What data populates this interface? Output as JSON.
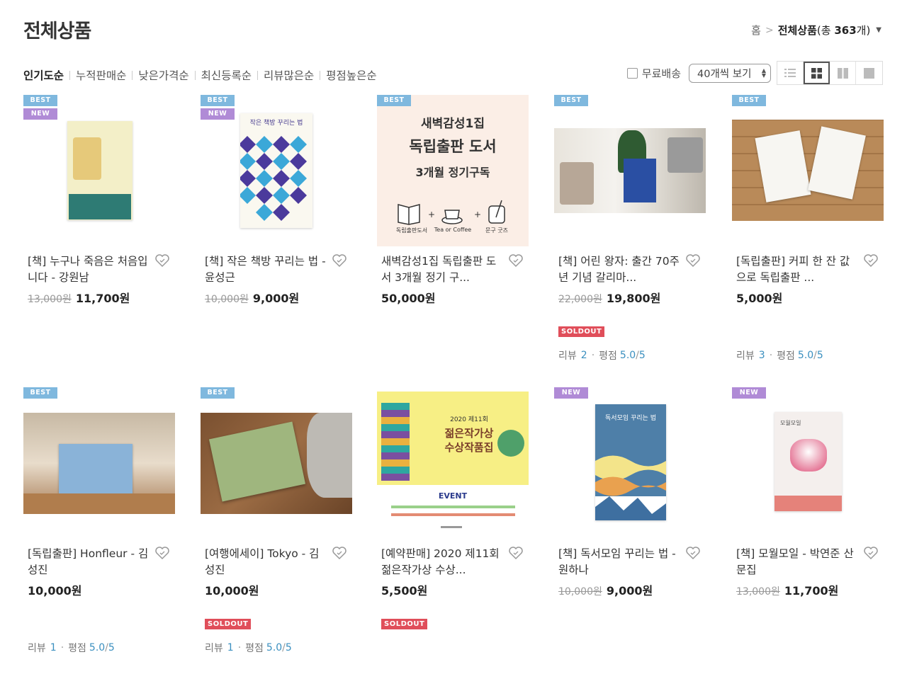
{
  "page": {
    "title": "전체상품"
  },
  "breadcrumb": {
    "home": "홈",
    "current": "전체상품",
    "count_prefix": "(총 ",
    "count_value": "363",
    "count_suffix": "개)"
  },
  "sort_tabs": [
    "인기도순",
    "누적판매순",
    "낮은가격순",
    "최신등록순",
    "리뷰많은순",
    "평점높은순"
  ],
  "toolbar": {
    "free_shipping_label": "무료배송",
    "view_count_value": "40개씩 보기"
  },
  "review_labels": {
    "review": "리뷰",
    "rating": "평점",
    "max": "5"
  },
  "soldout_label": "SOLDOUT",
  "badge_labels": {
    "best": "BEST",
    "new": "NEW"
  },
  "products": [
    {
      "title": "[책] 누구나 죽음은 처음입니다 - 강원남",
      "orig_price": "13,000원",
      "price": "11,700원",
      "badges": [
        "best",
        "new"
      ],
      "soldout": false,
      "review_count": "",
      "rating": "",
      "thumb_text": ""
    },
    {
      "title": "[책] 작은 책방 꾸리는 법 - 윤성근",
      "orig_price": "10,000원",
      "price": "9,000원",
      "badges": [
        "best",
        "new"
      ],
      "soldout": false,
      "review_count": "",
      "rating": "",
      "thumb_text": "작은 책방 꾸리는 법"
    },
    {
      "title": "새벽감성1집 독립출판 도서 3개월 정기 구...",
      "orig_price": "",
      "price": "50,000원",
      "badges": [
        "best"
      ],
      "soldout": false,
      "review_count": "",
      "rating": "",
      "thumb_text": "새벽감성1집",
      "thumb_text2": "독립출판 도서",
      "thumb_text3": "3개월 정기구독",
      "thumb_items": [
        "독립출판도서",
        "Tea or Coffee",
        "문구 굿즈"
      ]
    },
    {
      "title": "[책] 어린 왕자: 출간 70주년 기념 갈리마...",
      "orig_price": "22,000원",
      "price": "19,800원",
      "badges": [
        "best"
      ],
      "soldout": true,
      "review_count": "2",
      "rating": "5.0",
      "thumb_text": ""
    },
    {
      "title": "[독립출판] 커피 한 잔 값으로 독립출판 ...",
      "orig_price": "",
      "price": "5,000원",
      "badges": [
        "best"
      ],
      "soldout": false,
      "review_count": "3",
      "rating": "5.0",
      "thumb_text": ""
    },
    {
      "title": "[독립출판] Honfleur - 김성진",
      "orig_price": "",
      "price": "10,000원",
      "badges": [
        "best"
      ],
      "soldout": false,
      "review_count": "1",
      "rating": "5.0",
      "thumb_text": ""
    },
    {
      "title": "[여행에세이] Tokyo - 김성진",
      "orig_price": "",
      "price": "10,000원",
      "badges": [
        "best"
      ],
      "soldout": true,
      "review_count": "1",
      "rating": "5.0",
      "thumb_text": ""
    },
    {
      "title": "[예약판매] 2020 제11회 젊은작가상 수상...",
      "orig_price": "",
      "price": "5,500원",
      "badges": [],
      "soldout": true,
      "review_count": "",
      "rating": "",
      "thumb_text": "2020 제11회",
      "thumb_text2": "젊은작가상",
      "thumb_text3": "수상작품집",
      "thumb_text4": "EVENT"
    },
    {
      "title": "[책] 독서모임 꾸리는 법 - 원하나",
      "orig_price": "10,000원",
      "price": "9,000원",
      "badges": [
        "new"
      ],
      "soldout": false,
      "review_count": "",
      "rating": "",
      "thumb_text": "독서모임 꾸리는 법"
    },
    {
      "title": "[책] 모월모일 - 박연준 산문집",
      "orig_price": "13,000원",
      "price": "11,700원",
      "badges": [
        "new"
      ],
      "soldout": false,
      "review_count": "",
      "rating": "",
      "thumb_text": "모월모일"
    }
  ]
}
